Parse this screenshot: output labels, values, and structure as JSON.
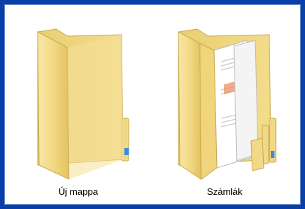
{
  "window": {
    "background_color": "#0a3fa8",
    "panel_color": "#ffffff"
  },
  "items": [
    {
      "label": "Új mappa",
      "icon": "empty-folder-icon"
    },
    {
      "label": "Számlák",
      "icon": "documents-folder-icon"
    }
  ]
}
